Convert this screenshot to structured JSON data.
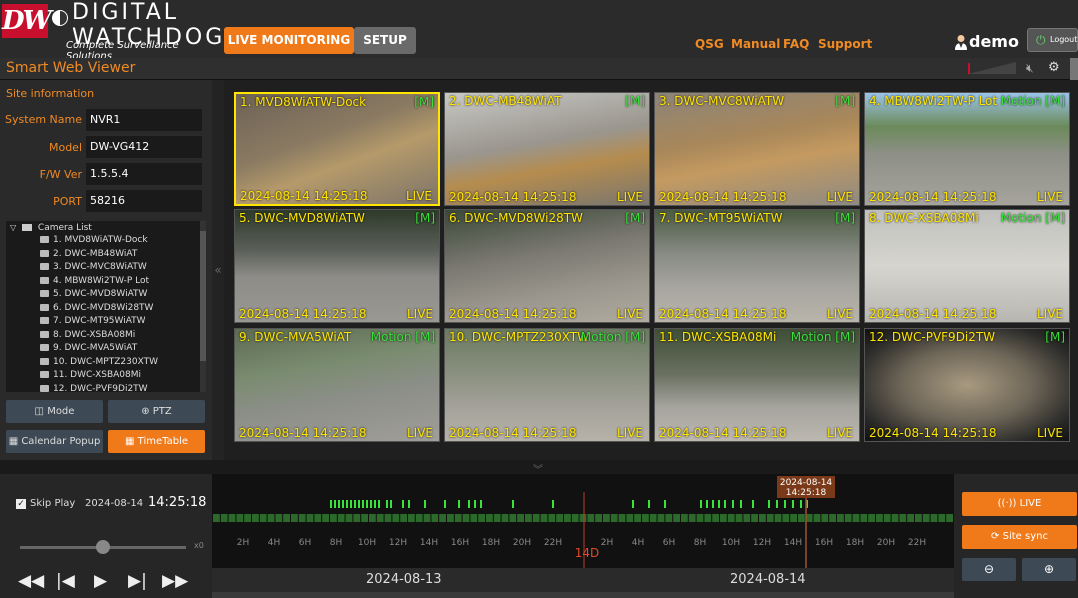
{
  "header": {
    "brand_short": "DW",
    "brand_name": "DIGITAL WATCHDOG",
    "tagline": "Complete Surveillance Solutions",
    "nav": {
      "live": "LIVE MONITORING",
      "setup": "SETUP"
    },
    "links": [
      "QSG",
      "Manual",
      "FAQ",
      "Support"
    ],
    "user": "demo",
    "logout": "Logout"
  },
  "subbar": {
    "title": "Smart Web Viewer"
  },
  "site": {
    "heading": "Site information",
    "fields": [
      {
        "label": "System Name",
        "value": "NVR1"
      },
      {
        "label": "Model",
        "value": "DW-VG412"
      },
      {
        "label": "F/W Ver",
        "value": "1.5.5.4"
      },
      {
        "label": "PORT",
        "value": "58216"
      }
    ]
  },
  "camera_list": {
    "heading": "Camera List",
    "items": [
      "1. MVD8WiATW-Dock",
      "2. DWC-MB48WiAT",
      "3. DWC-MVC8WiATW",
      "4. MBW8Wi2TW-P Lot",
      "5. DWC-MVD8WiATW",
      "6. DWC-MVD8Wi28TW",
      "7. DWC-MT95WiATW",
      "8. DWC-XSBA08Mi",
      "9. DWC-MVA5WiAT",
      "10. DWC-MPTZ230XTW",
      "11. DWC-XSBA08Mi",
      "12. DWC-PVF9Di2TW"
    ]
  },
  "buttons": {
    "mode": "Mode",
    "ptz": "PTZ",
    "calendar": "Calendar Popup",
    "timetable": "TimeTable"
  },
  "tiles": [
    {
      "name": "1. MVD8WiATW-Dock",
      "flag": "[M]",
      "time": "2024-08-14 14:25:18",
      "status": "LIVE"
    },
    {
      "name": "2. DWC-MB48WiAT",
      "flag": "[M]",
      "time": "2024-08-14 14:25:18",
      "status": "LIVE"
    },
    {
      "name": "3. DWC-MVC8WiATW",
      "flag": "[M]",
      "time": "2024-08-14 14:25:18",
      "status": "LIVE"
    },
    {
      "name": "4. MBW8Wi2TW-P Lot",
      "flag": "Motion [M]",
      "time": "2024-08-14 14:25:18",
      "status": "LIVE"
    },
    {
      "name": "5. DWC-MVD8WiATW",
      "flag": "[M]",
      "time": "2024-08-14 14:25:18",
      "status": "LIVE"
    },
    {
      "name": "6. DWC-MVD8Wi28TW",
      "flag": "[M]",
      "time": "2024-08-14 14:25:18",
      "status": "LIVE"
    },
    {
      "name": "7. DWC-MT95WiATW",
      "flag": "[M]",
      "time": "2024-08-14 14:25:18",
      "status": "LIVE"
    },
    {
      "name": "8. DWC-XSBA08Mi",
      "flag": "Motion [M]",
      "time": "2024-08-14 14:25:18",
      "status": "LIVE"
    },
    {
      "name": "9. DWC-MVA5WiAT",
      "flag": "Motion [M]",
      "time": "2024-08-14 14:25:18",
      "status": "LIVE"
    },
    {
      "name": "10. DWC-MPTZ230XTW",
      "flag": "Motion [M]",
      "time": "2024-08-14 14:25:18",
      "status": "LIVE"
    },
    {
      "name": "11. DWC-XSBA08Mi",
      "flag": "Motion [M]",
      "time": "2024-08-14 14:25:18",
      "status": "LIVE"
    },
    {
      "name": "12. DWC-PVF9Di2TW",
      "flag": "[M]",
      "time": "2024-08-14 14:25:18",
      "status": "LIVE"
    }
  ],
  "playback": {
    "skip_play": "Skip Play",
    "date": "2024-08-14",
    "time": "14:25:18",
    "speed": "x0",
    "speed_level": 0.5
  },
  "timeline": {
    "cursor_label": "2024-08-14\n14:25:18",
    "cursor_date": "2024-08-14",
    "cursor_time": "14:25:18",
    "span_label": "14D",
    "hour_labels": [
      "2H",
      "4H",
      "6H",
      "8H",
      "10H",
      "12H",
      "14H",
      "16H",
      "18H",
      "20H",
      "22H"
    ],
    "days": [
      "2024-08-13",
      "2024-08-14"
    ]
  },
  "right_buttons": {
    "live": "LIVE",
    "sync": "Site sync",
    "zoom_out": "zoom-out",
    "zoom_in": "zoom-in"
  },
  "colors": {
    "accent": "#f07a1a",
    "label": "#f08a24",
    "overlay": "#ffe500",
    "motion": "#3adf3a",
    "cursor": "#c0392b"
  }
}
